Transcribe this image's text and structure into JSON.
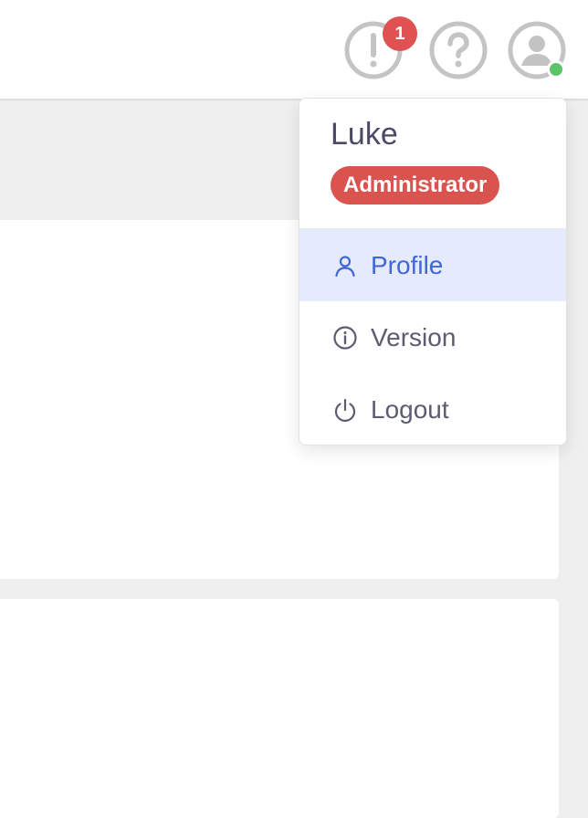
{
  "topbar": {
    "alerts": {
      "icon": "alert-circle-icon",
      "count": "1"
    },
    "help": {
      "icon": "help-circle-icon"
    },
    "user": {
      "icon": "user-avatar-icon",
      "status": "online",
      "status_color": "#5cc56a"
    }
  },
  "user_menu": {
    "username": "Luke",
    "role": "Administrator",
    "role_color": "#d9534f",
    "items": [
      {
        "label": "Profile",
        "icon": "user-icon",
        "active": true
      },
      {
        "label": "Version",
        "icon": "info-icon",
        "active": false
      },
      {
        "label": "Logout",
        "icon": "power-icon",
        "active": false
      }
    ]
  },
  "colors": {
    "accent": "#3f67d9",
    "accent_bg": "#e5ebfc",
    "badge": "#e05252",
    "icon_gray": "#c4c4c4"
  }
}
